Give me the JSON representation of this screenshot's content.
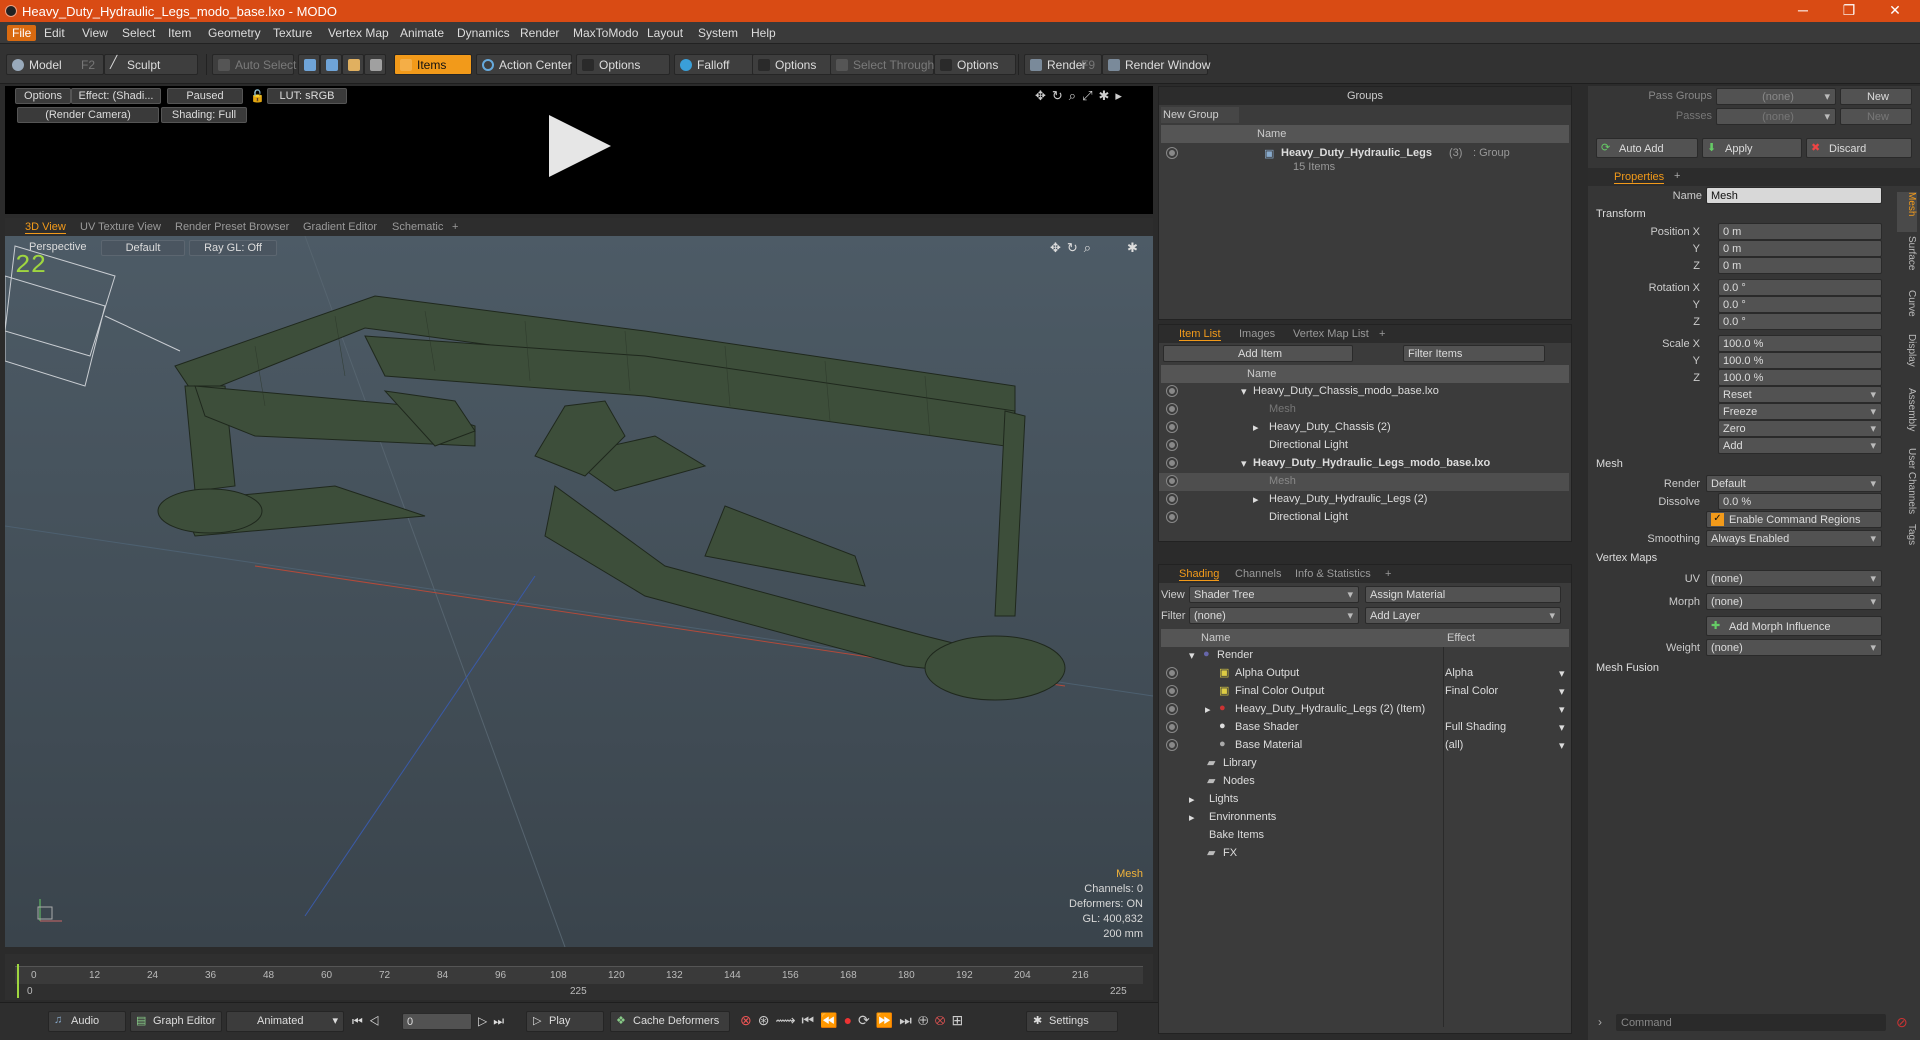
{
  "window": {
    "title": "Heavy_Duty_Hydraulic_Legs_modo_base.lxo - MODO"
  },
  "menu": [
    "File",
    "Edit",
    "View",
    "Select",
    "Item",
    "Geometry",
    "Texture",
    "Vertex Map",
    "Animate",
    "Dynamics",
    "Render",
    "MaxToModo",
    "Layout",
    "System",
    "Help"
  ],
  "toolbar": {
    "model": "Model",
    "model_key": "F2",
    "sculpt": "Sculpt",
    "auto_select": "Auto Select",
    "items": "Items",
    "action_center": "Action Center",
    "options1": "Options",
    "falloff": "Falloff",
    "options2": "Options",
    "select_through": "Select Through",
    "options3": "Options",
    "render": "Render",
    "render_key": "F9",
    "render_window": "Render Window"
  },
  "preview": {
    "options": "Options",
    "effect": "Effect: (Shadi...",
    "paused": "Paused",
    "lut": "LUT: sRGB",
    "camera": "(Render Camera)",
    "shading": "Shading: Full"
  },
  "view_tabs": [
    "3D View",
    "UV Texture View",
    "Render Preset Browser",
    "Gradient Editor",
    "Schematic",
    "+"
  ],
  "viewport": {
    "perspective": "Perspective",
    "default": "Default",
    "raygl": "Ray GL: Off",
    "info_title": "Mesh",
    "channels": "Channels: 0",
    "deformers": "Deformers: ON",
    "gl": "GL: 400,832",
    "scale": "200 mm"
  },
  "timeline": {
    "ticks": [
      "0",
      "12",
      "24",
      "36",
      "48",
      "60",
      "72",
      "84",
      "96",
      "108",
      "120",
      "132",
      "144",
      "156",
      "168",
      "180",
      "192",
      "204",
      "216"
    ],
    "start": "0",
    "mid": "225",
    "end": "225"
  },
  "bottom": {
    "audio": "Audio",
    "graph_editor": "Graph Editor",
    "animated": "Animated",
    "frame": "0",
    "play": "Play",
    "cache": "Cache Deformers",
    "settings": "Settings"
  },
  "groups": {
    "title": "Groups",
    "new_group": "New Group",
    "col_name": "Name",
    "item_name": "Heavy_Duty_Hydraulic_Legs",
    "item_count": "(3)",
    "item_type": ": Group",
    "item_sub": "15 Items"
  },
  "itemlist": {
    "tabs": [
      "Item List",
      "Images",
      "Vertex Map List",
      "+"
    ],
    "add_item": "Add Item",
    "filter": "Filter Items",
    "col_name": "Name",
    "rows": [
      "Heavy_Duty_Chassis_modo_base.lxo",
      "Mesh",
      "Heavy_Duty_Chassis (2)",
      "Directional Light",
      "Heavy_Duty_Hydraulic_Legs_modo_base.lxo",
      "Mesh",
      "Heavy_Duty_Hydraulic_Legs (2)",
      "Directional Light"
    ]
  },
  "shading": {
    "tabs": [
      "Shading",
      "Channels",
      "Info & Statistics",
      "+"
    ],
    "view_label": "View",
    "view_value": "Shader Tree",
    "assign": "Assign Material",
    "filter_label": "Filter",
    "filter_value": "(none)",
    "add_layer": "Add Layer",
    "col_name": "Name",
    "col_effect": "Effect",
    "rows": [
      {
        "name": "Render",
        "effect": ""
      },
      {
        "name": "Alpha Output",
        "effect": "Alpha"
      },
      {
        "name": "Final Color Output",
        "effect": "Final Color"
      },
      {
        "name": "Heavy_Duty_Hydraulic_Legs (2) (Item)",
        "effect": ""
      },
      {
        "name": "Base Shader",
        "effect": "Full Shading"
      },
      {
        "name": "Base Material",
        "effect": "(all)"
      },
      {
        "name": "Library",
        "effect": ""
      },
      {
        "name": "Nodes",
        "effect": ""
      },
      {
        "name": "Lights",
        "effect": ""
      },
      {
        "name": "Environments",
        "effect": ""
      },
      {
        "name": "Bake Items",
        "effect": ""
      },
      {
        "name": "FX",
        "effect": ""
      }
    ]
  },
  "props": {
    "pass_groups": "Pass Groups",
    "passes": "Passes",
    "none": "(none)",
    "new": "New",
    "auto_add": "Auto Add",
    "apply": "Apply",
    "discard": "Discard",
    "tab": "Properties",
    "name_label": "Name",
    "name_value": "Mesh",
    "transform": "Transform",
    "pos_x": "Position X",
    "y": "Y",
    "z": "Z",
    "rot_x": "Rotation X",
    "scale_x": "Scale X",
    "pos_val": "0 m",
    "rot_val": "0.0 °",
    "scale_val": "100.0 %",
    "reset": "Reset",
    "freeze": "Freeze",
    "zero": "Zero",
    "add": "Add",
    "mesh": "Mesh",
    "render_label": "Render",
    "render_value": "Default",
    "dissolve_label": "Dissolve",
    "dissolve_value": "0.0 %",
    "enable_cmd": "Enable Command Regions",
    "smoothing_label": "Smoothing",
    "smoothing_value": "Always Enabled",
    "vertex_maps": "Vertex Maps",
    "uv": "UV",
    "morph": "Morph",
    "add_morph": "Add Morph Influence",
    "weight": "Weight",
    "mesh_fusion": "Mesh Fusion",
    "command": "Command",
    "side_tabs": [
      "Mesh",
      "Surface",
      "Curve",
      "Display",
      "Assembly",
      "User Channels",
      "Tags"
    ]
  }
}
